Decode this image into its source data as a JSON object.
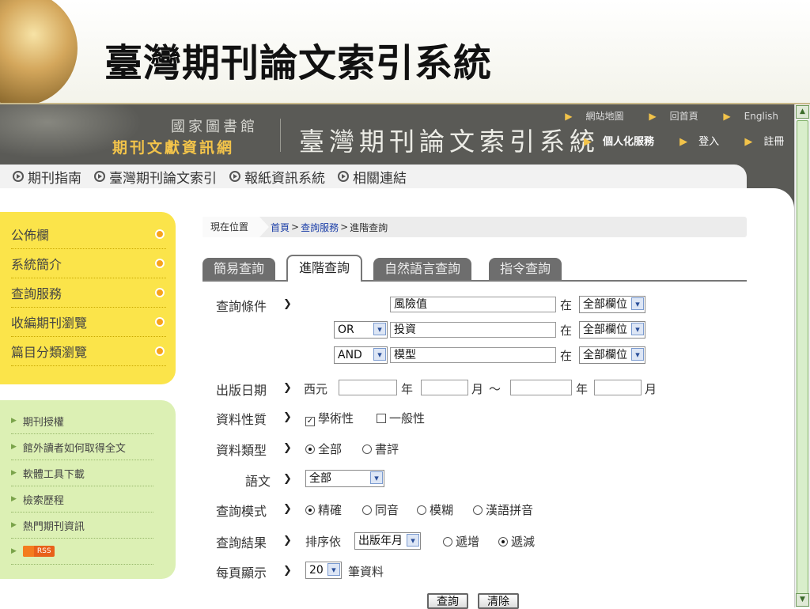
{
  "slide": {
    "title": "臺灣期刊論文索引系統"
  },
  "banner": {
    "library_name": "國家圖書館",
    "sub_brand": "期刊文獻資訊網",
    "system_title": "臺灣期刊論文索引系統",
    "top_links": [
      "網站地圖",
      "回首頁",
      "English"
    ],
    "personal_service": "個人化服務",
    "login": "登入",
    "register": "註冊"
  },
  "nav": [
    "期刊指南",
    "臺灣期刊論文索引",
    "報紙資訊系統",
    "相關連結"
  ],
  "sidebar": {
    "main_items": [
      "公佈欄",
      "系統簡介",
      "查詢服務",
      "收編期刊瀏覽",
      "篇目分類瀏覽"
    ],
    "sub_items": [
      "期刊授權",
      "館外讀者如何取得全文",
      "軟體工具下載",
      "檢索歷程",
      "熱門期刊資訊"
    ],
    "rss_label": "RSS"
  },
  "breadcrumb": {
    "label": "現在位置",
    "home": "首頁",
    "sep": ">",
    "service": "查詢服務",
    "current": "進階查詢"
  },
  "tabs": [
    "簡易查詢",
    "進階查詢",
    "自然語言查詢",
    "指令查詢"
  ],
  "form": {
    "chevron": "❯",
    "query_label": "查詢條件",
    "in_label": "在",
    "rows": [
      {
        "operator": "",
        "term": "風險值",
        "field": "全部欄位"
      },
      {
        "operator": "OR",
        "term": "投資",
        "field": "全部欄位"
      },
      {
        "operator": "AND",
        "term": "模型",
        "field": "全部欄位"
      }
    ],
    "date_label": "出版日期",
    "era": "西元",
    "year": "年",
    "month": "月",
    "tilde": "～",
    "nature_label": "資料性質",
    "nature_options": [
      {
        "label": "學術性",
        "checked": true
      },
      {
        "label": "一般性",
        "checked": false
      }
    ],
    "type_label": "資料類型",
    "type_options": [
      {
        "label": "全部",
        "selected": true
      },
      {
        "label": "書評",
        "selected": false
      }
    ],
    "lang_label": "語文",
    "lang_value": "全部",
    "mode_label": "查詢模式",
    "mode_options": [
      {
        "label": "精確",
        "selected": true
      },
      {
        "label": "同音",
        "selected": false
      },
      {
        "label": "模糊",
        "selected": false
      },
      {
        "label": "漢語拼音",
        "selected": false
      }
    ],
    "result_label": "查詢結果",
    "sort_prefix": "排序依",
    "sort_value": "出版年月",
    "order_options": [
      {
        "label": "遞增",
        "selected": false
      },
      {
        "label": "遞減",
        "selected": true
      }
    ],
    "perpage_label": "每頁顯示",
    "perpage_value": "20",
    "perpage_suffix": "筆資料",
    "search_button": "查詢",
    "clear_button": "清除"
  },
  "colors": {
    "sidebar_yellow": "#fbe44a",
    "sidebar_green": "#dcf0b4",
    "banner": "#5a5a56"
  }
}
